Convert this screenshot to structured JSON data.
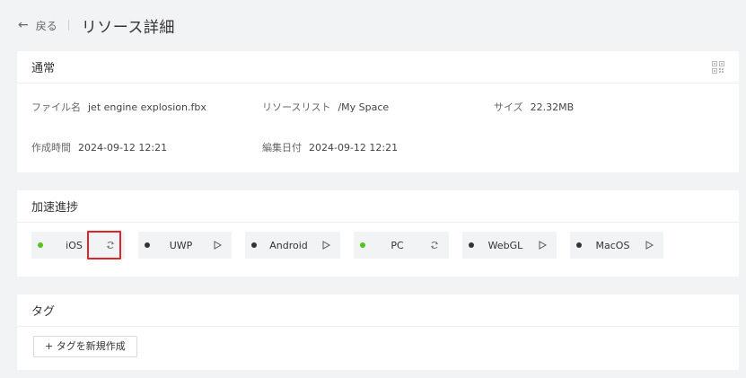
{
  "header": {
    "back_label": "戻る",
    "title": "リソース詳細"
  },
  "general": {
    "title": "通常",
    "icon": "qr-code-icon",
    "fields": {
      "filename": {
        "label": "ファイル名",
        "value": "jet engine explosion.fbx"
      },
      "resource_list": {
        "label": "リソースリスト",
        "value": "/My Space"
      },
      "size": {
        "label": "サイズ",
        "value": "22.32MB"
      },
      "created": {
        "label": "作成時間",
        "value": "2024-09-12 12:21"
      },
      "edited": {
        "label": "編集日付",
        "value": "2024-09-12 12:21"
      }
    }
  },
  "progress": {
    "title": "加速進捗",
    "platforms": [
      {
        "name": "iOS",
        "status_color": "#52c41a",
        "action": "refresh-icon"
      },
      {
        "name": "UWP",
        "status_color": "#333333",
        "action": "play-icon"
      },
      {
        "name": "Android",
        "status_color": "#333333",
        "action": "play-icon"
      },
      {
        "name": "PC",
        "status_color": "#52c41a",
        "action": "refresh-icon"
      },
      {
        "name": "WebGL",
        "status_color": "#333333",
        "action": "play-icon"
      },
      {
        "name": "MacOS",
        "status_color": "#333333",
        "action": "play-icon"
      }
    ]
  },
  "tags": {
    "title": "タグ",
    "new_tag_label": "+ タグを新規作成"
  },
  "colors": {
    "background": "#f2f3f5",
    "card": "#ffffff",
    "green": "#52c41a",
    "highlight": "#e0242b"
  }
}
